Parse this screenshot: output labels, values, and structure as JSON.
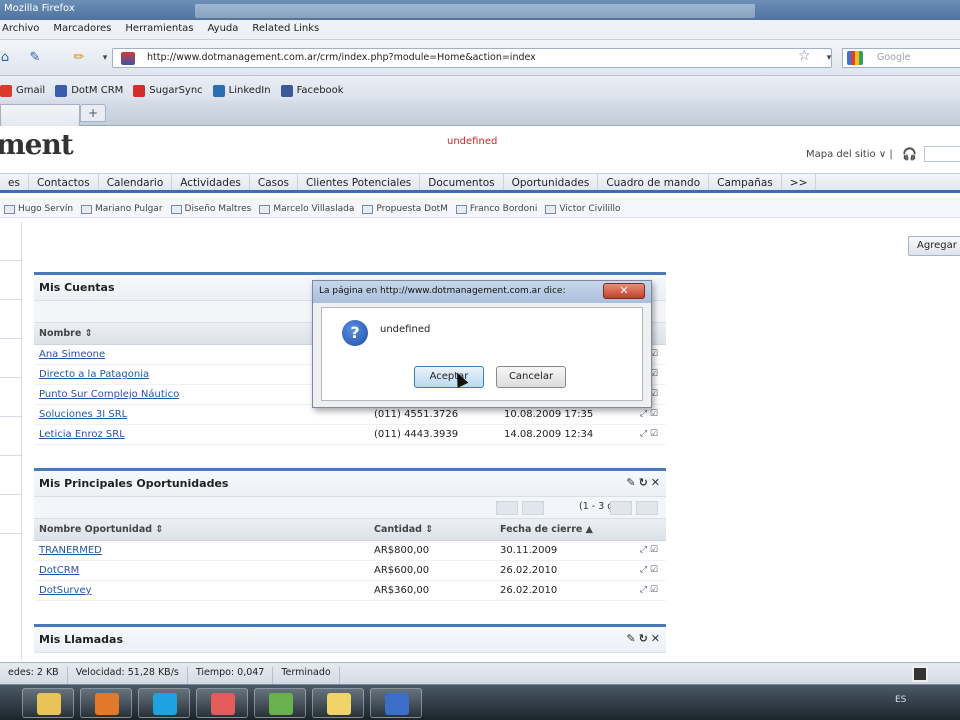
{
  "window": {
    "title": "Mozilla Firefox"
  },
  "menu": [
    "Archivo",
    "Marcadores",
    "Herramientas",
    "Ayuda",
    "Related Links"
  ],
  "address": {
    "url": "http://www.dotmanagement.com.ar/crm/index.php?module=Home&action=index",
    "search_placeholder": "Google"
  },
  "bookmarks": [
    {
      "label": "Gmail",
      "color": "#d93b2b"
    },
    {
      "label": "DotM CRM",
      "color": "#3b5db0"
    },
    {
      "label": "SugarSync",
      "color": "#d12d2d"
    },
    {
      "label": "LinkedIn",
      "color": "#2a6fb4"
    },
    {
      "label": "Facebook",
      "color": "#3b5998"
    }
  ],
  "page": {
    "logo": "ment",
    "undefined_msg": "undefined",
    "sitemap": "Mapa del sitio ∨ |",
    "modules": [
      "es",
      "Contactos",
      "Calendario",
      "Actividades",
      "Casos",
      "Clientes Potenciales",
      "Documentos",
      "Oportunidades",
      "Cuadro de mando",
      "Campañas",
      ">>"
    ],
    "last_viewed": [
      "Hugo Servín",
      "Mariano Pulgar",
      "Diseño Maltres",
      "Marcelo Villaslada",
      "Propuesta DotM",
      "Franco Bordoni",
      "Victor Civilillo"
    ],
    "add_button": "Agregar"
  },
  "cuentas": {
    "title": "Mis Cuentas",
    "col_name": "Nombre",
    "rows": [
      {
        "name": "Ana Simeone",
        "phone": "",
        "date": ""
      },
      {
        "name": "Directo a la Patagonia",
        "phone": "",
        "date": ""
      },
      {
        "name": "Punto Sur Complejo Náutico",
        "phone": "",
        "date": ""
      },
      {
        "name": "Soluciones 3I SRL",
        "phone": "(011) 4551.3726",
        "date": "10.08.2009 17:35"
      },
      {
        "name": "Leticia Enroz SRL",
        "phone": "(011) 4443.3939",
        "date": "14.08.2009 12:34"
      }
    ]
  },
  "oportunidades": {
    "title": "Mis Principales Oportunidades",
    "pager": "(1 - 3 de 3)",
    "cols": [
      "Nombre Oportunidad",
      "Cantidad",
      "Fecha de cierre"
    ],
    "rows": [
      {
        "name": "TRANERMED",
        "amount": "AR$800,00",
        "date": "30.11.2009"
      },
      {
        "name": "DotCRM",
        "amount": "AR$600,00",
        "date": "26.02.2010"
      },
      {
        "name": "DotSurvey",
        "amount": "AR$360,00",
        "date": "26.02.2010"
      }
    ]
  },
  "llamadas": {
    "title": "Mis Llamadas"
  },
  "dialog": {
    "title": "La página en http://www.dotmanagement.com.ar dice:",
    "message": "undefined",
    "ok": "Aceptar",
    "cancel": "Cancelar"
  },
  "status": [
    "edes: 2 KB",
    "Velocidad: 51,28 KB/s",
    "Tiempo: 0,047",
    "Terminado"
  ],
  "taskbar": {
    "apps": [
      {
        "name": "explorer",
        "color": "#e8c35a"
      },
      {
        "name": "media",
        "color": "#e07a2a"
      },
      {
        "name": "skype",
        "color": "#1ea3e0"
      },
      {
        "name": "chat",
        "color": "#e35b5b"
      },
      {
        "name": "people",
        "color": "#6ab04c"
      },
      {
        "name": "folder",
        "color": "#f0d36a"
      },
      {
        "name": "firefox",
        "color": "#3b6ec9"
      }
    ],
    "tray_lang": "ES"
  }
}
